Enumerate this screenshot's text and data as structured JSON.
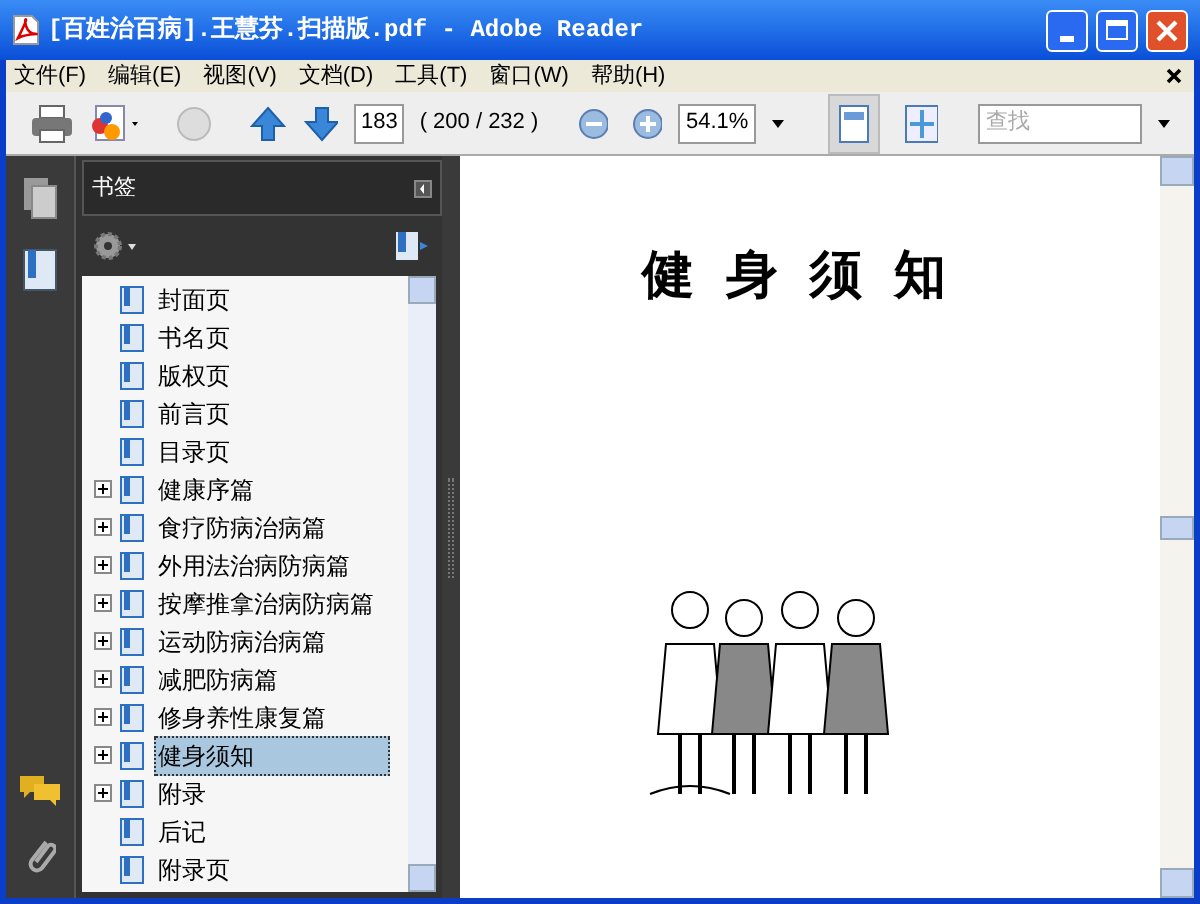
{
  "window": {
    "title": "[百姓治百病].王慧芬.扫描版.pdf - Adobe Reader"
  },
  "menu": [
    "文件(F)",
    "编辑(E)",
    "视图(V)",
    "文档(D)",
    "工具(T)",
    "窗口(W)",
    "帮助(H)"
  ],
  "toolbar": {
    "page_number": "183",
    "page_count": "( 200 / 232 )",
    "zoom": "54.1%",
    "search": {
      "placeholder": "查找"
    }
  },
  "bookmarks": {
    "title": "书签",
    "items": [
      {
        "label": "封面页",
        "kind": "leaf",
        "selected": false
      },
      {
        "label": "书名页",
        "kind": "leaf",
        "selected": false
      },
      {
        "label": "版权页",
        "kind": "leaf",
        "selected": false
      },
      {
        "label": "前言页",
        "kind": "leaf",
        "selected": false
      },
      {
        "label": "目录页",
        "kind": "leaf",
        "selected": false
      },
      {
        "label": "健康序篇",
        "kind": "collapsed",
        "selected": false
      },
      {
        "label": "食疗防病治病篇",
        "kind": "collapsed",
        "selected": false
      },
      {
        "label": "外用法治病防病篇",
        "kind": "collapsed",
        "selected": false
      },
      {
        "label": "按摩推拿治病防病篇",
        "kind": "collapsed",
        "selected": false
      },
      {
        "label": "运动防病治病篇",
        "kind": "collapsed",
        "selected": false
      },
      {
        "label": "减肥防病篇",
        "kind": "collapsed",
        "selected": false
      },
      {
        "label": "修身养性康复篇",
        "kind": "collapsed",
        "selected": false
      },
      {
        "label": "健身须知",
        "kind": "collapsed",
        "selected": true
      },
      {
        "label": "附录",
        "kind": "collapsed",
        "selected": false
      },
      {
        "label": "后记",
        "kind": "leaf",
        "selected": false
      },
      {
        "label": "附录页",
        "kind": "leaf",
        "selected": false
      }
    ]
  },
  "document": {
    "heading": "健身须知"
  }
}
